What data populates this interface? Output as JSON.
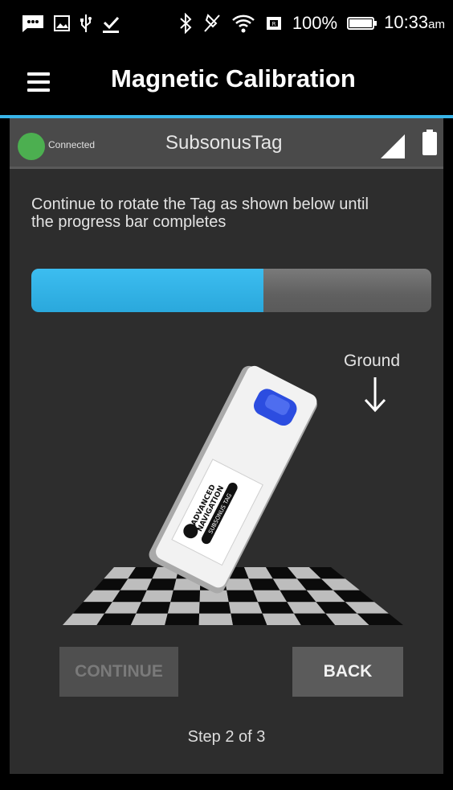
{
  "status_bar": {
    "battery_percent": "100%",
    "time": "10:33",
    "time_suffix": "am",
    "icons": [
      "message-icon",
      "image-icon",
      "usb-icon",
      "download-done-icon",
      "bluetooth-icon",
      "vibrate-off-icon",
      "wifi-icon",
      "sim-icon",
      "battery-icon"
    ]
  },
  "toolbar": {
    "title": "Magnetic Calibration"
  },
  "device": {
    "status": "Connected",
    "status_color": "#4caf50",
    "name": "SubsonusTag",
    "icons": [
      "signal-icon",
      "battery-icon"
    ]
  },
  "calibration": {
    "instructions": "Continue to rotate the Tag as shown below until the progress bar completes",
    "progress_fraction": 0.58,
    "progress_color": "#39b5e9",
    "ground_label": "Ground",
    "tag_label_line1": "ADVANCED",
    "tag_label_line2": "NAVIGATION",
    "tag_label_line3": "SUBSONUS TAG"
  },
  "buttons": {
    "continue_label": "CONTINUE",
    "back_label": "BACK"
  },
  "footer": {
    "step": "Step 2 of 3"
  }
}
